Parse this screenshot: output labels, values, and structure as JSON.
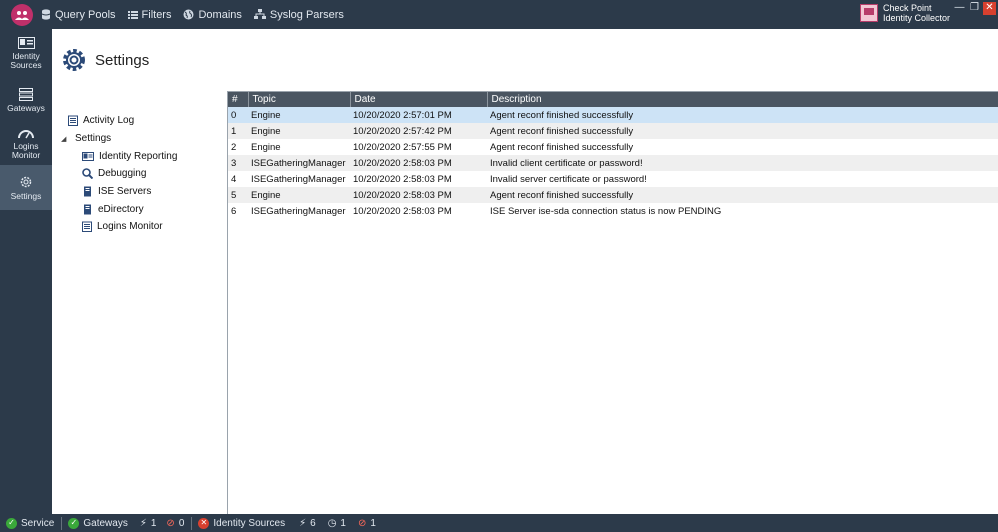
{
  "menubar": {
    "items": [
      {
        "label": "Query Pools",
        "icon": "database-icon"
      },
      {
        "label": "Filters",
        "icon": "list-icon"
      },
      {
        "label": "Domains",
        "icon": "globe-icon"
      },
      {
        "label": "Syslog Parsers",
        "icon": "network-icon"
      }
    ],
    "brand": {
      "line1": "Check Point",
      "line2": "Identity Collector"
    }
  },
  "leftnav": {
    "items": [
      {
        "label": "Identity Sources",
        "icon": "id-card-icon"
      },
      {
        "label": "Gateways",
        "icon": "server-icon"
      },
      {
        "label": "Logins Monitor",
        "icon": "gauge-icon"
      },
      {
        "label": "Settings",
        "icon": "gear-icon",
        "active": true
      }
    ]
  },
  "header": {
    "title": "Settings"
  },
  "tree": {
    "activity_log": "Activity Log",
    "settings": "Settings",
    "children": [
      "Identity Reporting",
      "Debugging",
      "ISE Servers",
      "eDirectory",
      "Logins Monitor"
    ]
  },
  "table": {
    "columns": [
      "#",
      "Topic",
      "Date",
      "Description"
    ],
    "rows": [
      [
        "0",
        "Engine",
        "10/20/2020 2:57:01 PM",
        "Agent reconf finished successfully"
      ],
      [
        "1",
        "Engine",
        "10/20/2020 2:57:42 PM",
        "Agent reconf finished successfully"
      ],
      [
        "2",
        "Engine",
        "10/20/2020 2:57:55 PM",
        "Agent reconf finished successfully"
      ],
      [
        "3",
        "ISEGatheringManager",
        "10/20/2020 2:58:03 PM",
        "Invalid client certificate or password!"
      ],
      [
        "4",
        "ISEGatheringManager",
        "10/20/2020 2:58:03 PM",
        "Invalid server certificate or password!"
      ],
      [
        "5",
        "Engine",
        "10/20/2020 2:58:03 PM",
        "Agent reconf finished successfully"
      ],
      [
        "6",
        "ISEGatheringManager",
        "10/20/2020 2:58:03 PM",
        "ISE Server ise-sda connection status is now PENDING"
      ]
    ],
    "selected_row": 0
  },
  "statusbar": {
    "service": "Service",
    "gateways": "Gateways",
    "gw_connected": "1",
    "gw_blocked": "0",
    "identity_sources": "Identity Sources",
    "is_connected": "6",
    "is_pending": "1",
    "is_blocked": "1"
  },
  "colors": {
    "ok": "#3aa83a",
    "error": "#d8402f",
    "bar": "#2c3a4a",
    "selection": "#cde3f6"
  }
}
